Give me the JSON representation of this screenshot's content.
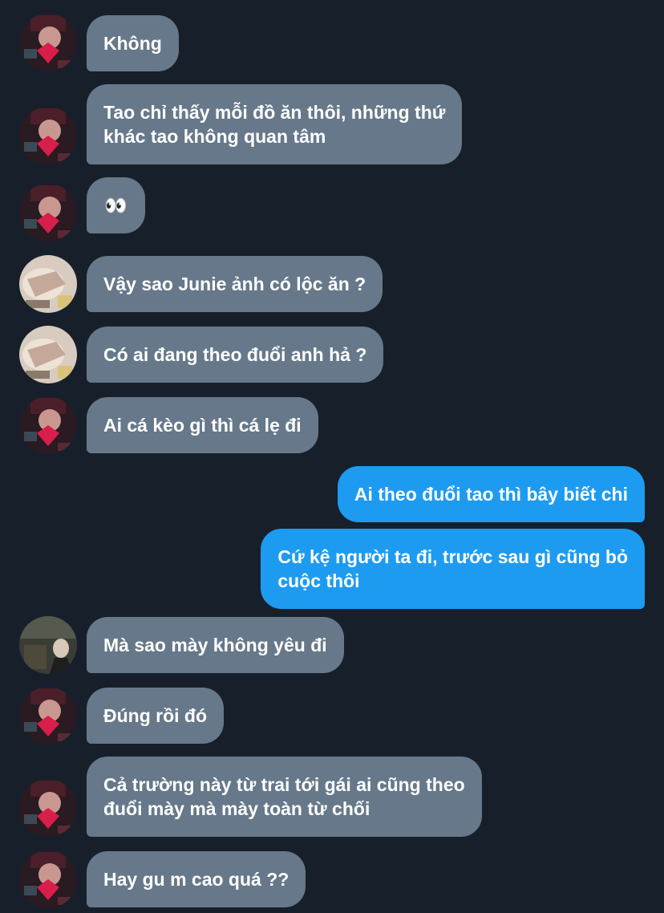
{
  "conversation": {
    "messages": [
      {
        "sender": "friend-a",
        "text": "Không"
      },
      {
        "sender": "friend-a",
        "text": "Tao chỉ thấy mỗi đồ ăn thôi, những thứ\nkhác tao không quan tâm"
      },
      {
        "sender": "friend-a",
        "text": "👀"
      },
      {
        "sender": "friend-b",
        "text": "Vậy sao Junie ảnh có lộc ăn ?"
      },
      {
        "sender": "friend-b",
        "text": "Có ai đang theo đuổi anh hả ?"
      },
      {
        "sender": "friend-a",
        "text": "Ai cá kèo gì thì cá lẹ đi"
      },
      {
        "sender": "me",
        "text": "Ai theo đuổi tao thì bây biết chi"
      },
      {
        "sender": "me",
        "text": "Cứ kệ người ta đi, trước sau gì cũng bỏ\ncuộc thôi"
      },
      {
        "sender": "friend-c",
        "text": "Mà sao mày không yêu đi"
      },
      {
        "sender": "friend-a",
        "text": "Đúng rồi đó"
      },
      {
        "sender": "friend-a",
        "text": "Cả trường này từ trai tới gái ai cũng theo\nđuổi mày mà mày toàn từ chối"
      },
      {
        "sender": "friend-a",
        "text": "Hay gu m cao quá ??"
      }
    ]
  },
  "colors": {
    "background": "#17202a",
    "incoming_bubble": "#66788a",
    "outgoing_bubble": "#1d9bf0",
    "text": "#ffffff"
  }
}
